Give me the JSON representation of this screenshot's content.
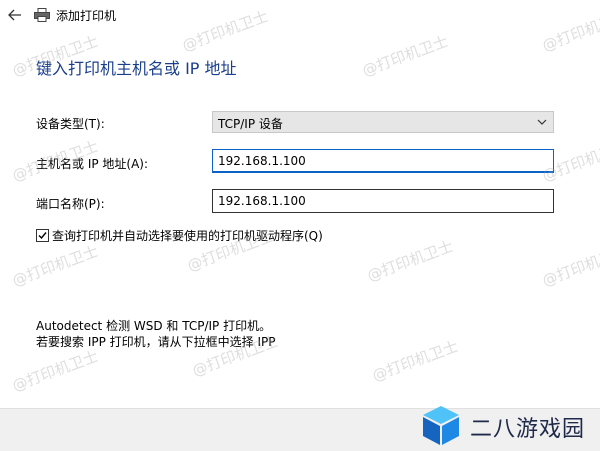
{
  "window": {
    "title": "添加打印机",
    "back_icon": "back-arrow-icon",
    "printer_icon": "printer-icon"
  },
  "page": {
    "heading": "键入打印机主机名或 IP 地址"
  },
  "form": {
    "device_type_label": "设备类型(T):",
    "device_type_value": "TCP/IP 设备",
    "hostname_label": "主机名或 IP 地址(A):",
    "hostname_value": "192.168.1.100",
    "port_label": "端口名称(P):",
    "port_value": "192.168.1.100",
    "query_checkbox_label": "查询打印机并自动选择要使用的打印机驱动程序(Q)",
    "query_checkbox_checked": true
  },
  "info": {
    "line1": "Autodetect 检测 WSD 和 TCP/IP 打印机。",
    "line2": "若要搜索 IPP 打印机，请从下拉框中选择 IPP"
  },
  "watermark": {
    "text": "@打印机卫士"
  },
  "branding": {
    "logo_text": "二八游戏园"
  },
  "colors": {
    "heading": "#1a3f8c",
    "focus_border": "#0a64c8",
    "logo_blue": "#1e88e5"
  }
}
